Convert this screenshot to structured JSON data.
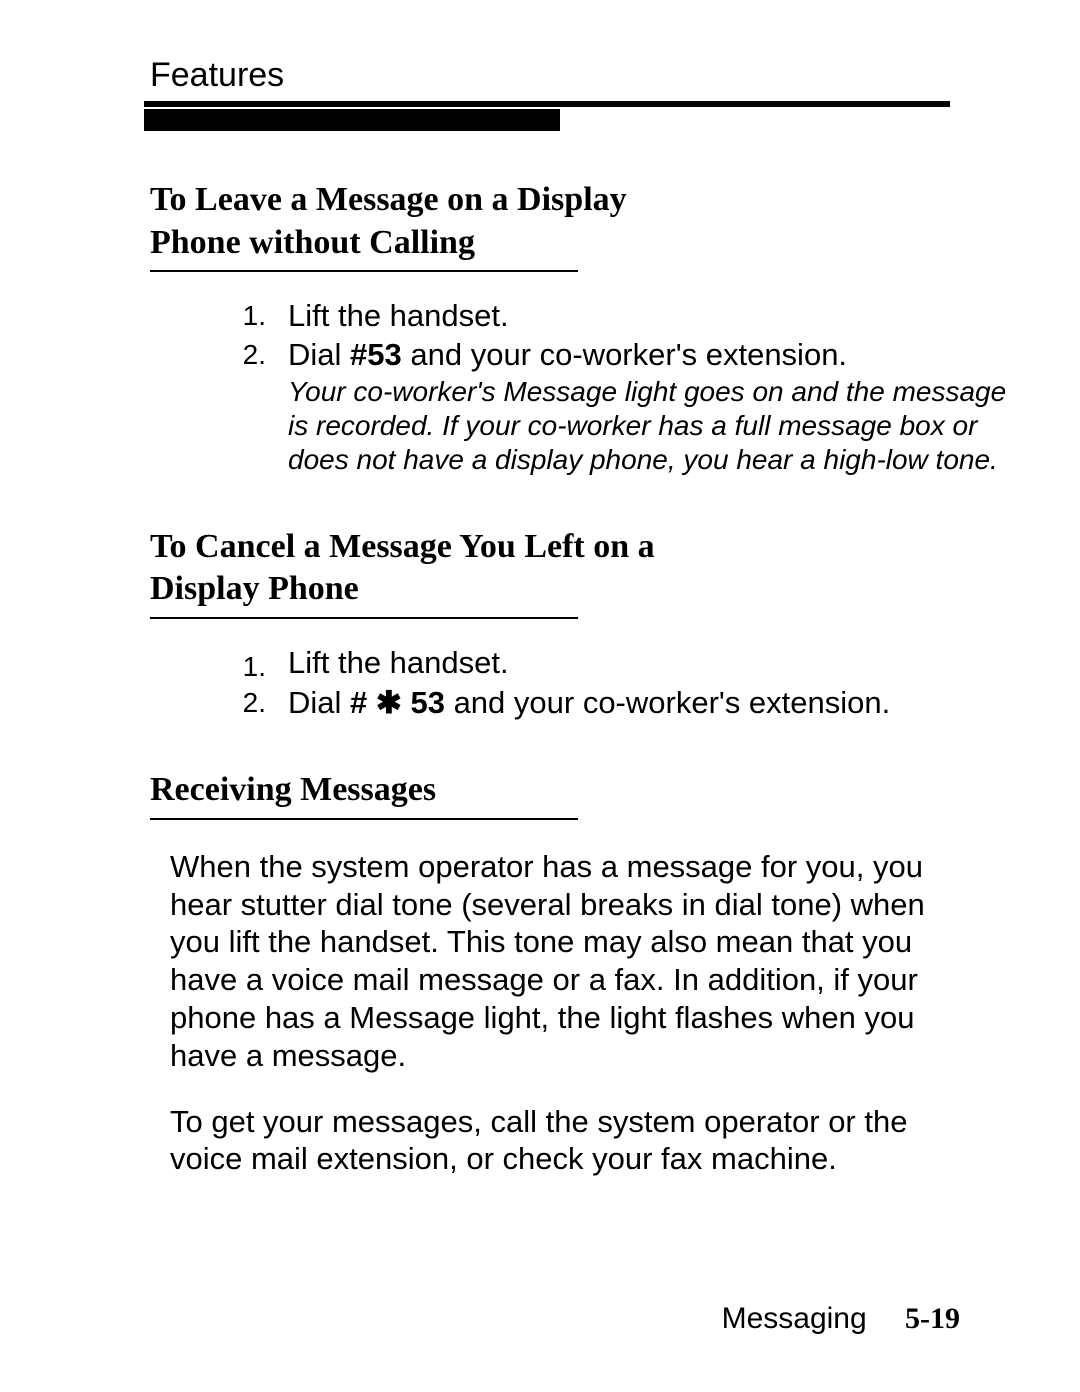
{
  "header": {
    "text": "Features"
  },
  "sections": [
    {
      "title_line1": "To Leave a Message on a Display",
      "title_line2": "Phone without Calling",
      "items": [
        {
          "num": "1.",
          "body": "Lift the handset."
        },
        {
          "num": "2.",
          "body_pre": "Dial ",
          "body_bold": "#53",
          "body_post": " and your co-worker's extension.",
          "note": "Your co-worker's Message light goes on and the message is recorded. If your co-worker has a full message box or does not have a display phone, you hear a high-low tone."
        }
      ]
    },
    {
      "title_line1": "To Cancel a Message You Left on a",
      "title_line2": "Display Phone",
      "items": [
        {
          "num": "1.",
          "body": "Lift the handset."
        },
        {
          "num": "2.",
          "body_pre": "Dial ",
          "body_bold": "# ✱ 53",
          "body_post": " and your co-worker's extension."
        }
      ]
    },
    {
      "title_line1": "Receiving Messages",
      "paragraphs": [
        "When the system operator has a message for you, you hear stutter dial tone (several breaks in dial tone) when you lift the handset. This tone may also mean that you have a voice mail message or a fax. In addition, if your phone has a Message light, the light flashes when you have a message.",
        "To get your messages, call the system operator or the voice mail extension, or check your fax machine."
      ]
    }
  ],
  "footer": {
    "label": "Messaging",
    "pagenum": "5-19"
  }
}
